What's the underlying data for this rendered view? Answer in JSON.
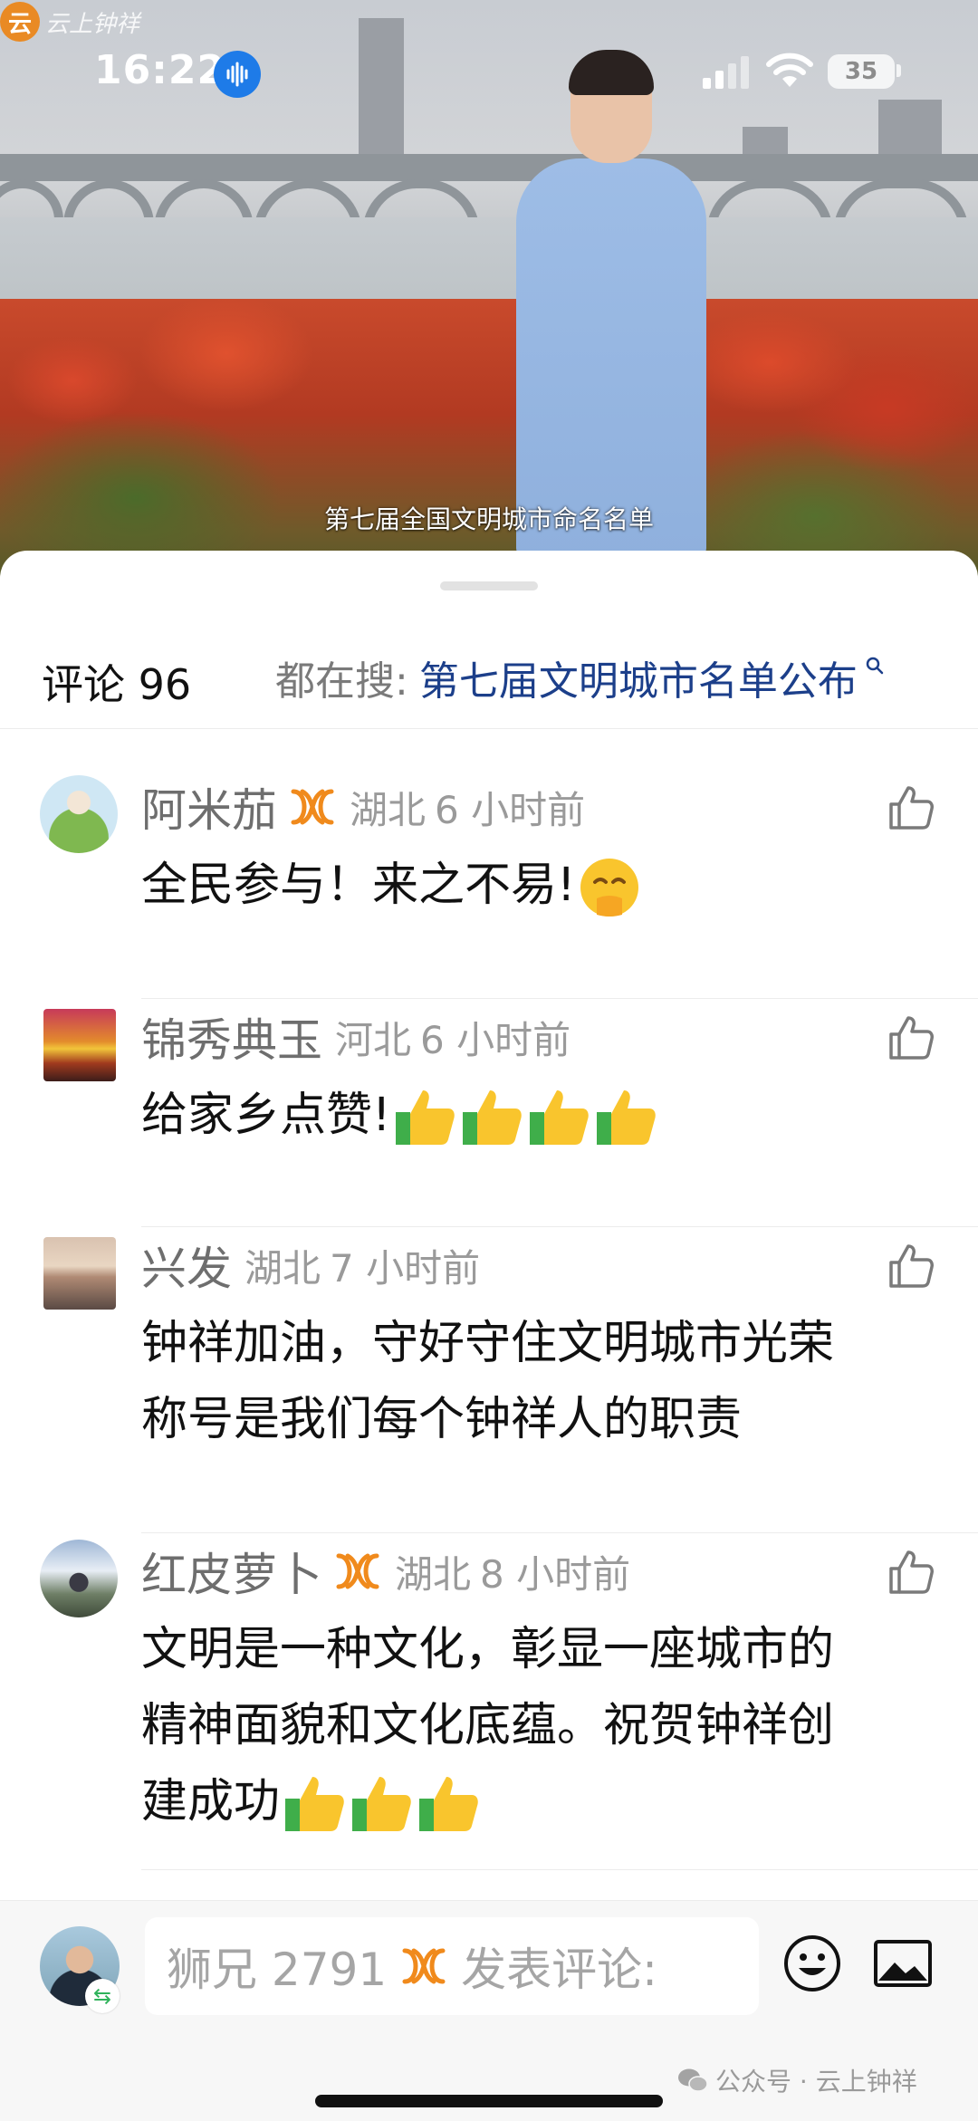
{
  "status_bar": {
    "time": "16:22",
    "battery": "35",
    "icons": [
      "voice-wave-icon",
      "signal-icon",
      "wifi-icon",
      "battery-icon"
    ]
  },
  "video": {
    "watermark_logo": "云",
    "watermark_text": "云上钟祥",
    "subtitle": "第七届全国文明城市命名名单"
  },
  "sheet": {
    "comments_label": "评论 96",
    "hot_search_prefix": "都在搜:",
    "hot_search_term": "第七届文明城市名单公布",
    "hot_search_icon": "search-icon"
  },
  "comments": [
    {
      "name": "阿米茄",
      "has_badge": true,
      "location": "湖北",
      "time": "6 小时前",
      "lines": [
        "全民参与！来之不易!"
      ],
      "emoji": [
        "shushing-face"
      ],
      "like_icon": "thumbs-up-outline-icon"
    },
    {
      "name": "锦秀典玉",
      "has_badge": false,
      "location": "河北",
      "time": "6 小时前",
      "lines": [
        "给家乡点赞!"
      ],
      "emoji": [
        "thumbs-up",
        "thumbs-up",
        "thumbs-up",
        "thumbs-up"
      ],
      "like_icon": "thumbs-up-outline-icon"
    },
    {
      "name": "兴发",
      "has_badge": false,
      "location": "湖北",
      "time": "7 小时前",
      "lines": [
        "钟祥加油，守好守住文明城市光荣",
        "称号是我们每个钟祥人的职责"
      ],
      "emoji": [],
      "like_icon": "thumbs-up-outline-icon"
    },
    {
      "name": "红皮萝卜",
      "has_badge": true,
      "location": "湖北",
      "time": "8 小时前",
      "lines": [
        "文明是一种文化，彰显一座城市的",
        "精神面貌和文化底蕴。祝贺钟祥创",
        "建成功"
      ],
      "emoji": [
        "thumbs-up",
        "thumbs-up",
        "thumbs-up"
      ],
      "like_icon": "thumbs-up-outline-icon"
    }
  ],
  "input_bar": {
    "user_name": "狮兄 2791",
    "placeholder": "发表评论:",
    "emoji_button_icon": "smiley-icon",
    "image_button_icon": "image-icon"
  },
  "footer_watermark": {
    "text": "公众号 · 云上钟祥",
    "icon": "wechat-icon"
  },
  "colors": {
    "link_blue": "#1c3f8a",
    "badge_orange": "#f08a1c",
    "muted_gray": "#9a9a9a",
    "name_gray": "#6e6e6e"
  }
}
